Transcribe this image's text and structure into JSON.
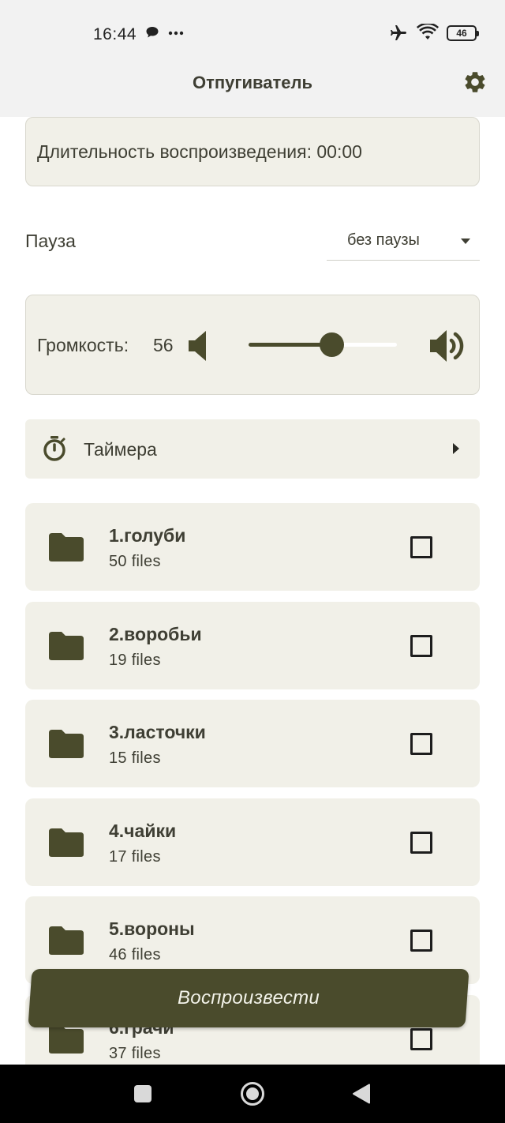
{
  "status_bar": {
    "time": "16:44",
    "battery_level": "46",
    "icons": [
      "chat-bubble-icon",
      "more-dots-icon",
      "airplane-icon",
      "wifi-icon",
      "battery-icon"
    ]
  },
  "app_bar": {
    "title": "Отпугиватель",
    "settings_icon": "gear-icon"
  },
  "duration": {
    "text": "Длительность воспроизведения: 00:00"
  },
  "pause": {
    "label": "Пауза",
    "selected": "без паузы"
  },
  "volume": {
    "label": "Громкость:",
    "value": "56",
    "level_percent": 56
  },
  "timers": {
    "label": "Таймера"
  },
  "folders": [
    {
      "name": "1.голуби",
      "count": "50 files",
      "checked": false
    },
    {
      "name": "2.воробьи",
      "count": "19 files",
      "checked": false
    },
    {
      "name": "3.ласточки",
      "count": "15 files",
      "checked": false
    },
    {
      "name": "4.чайки",
      "count": "17 files",
      "checked": false
    },
    {
      "name": "5.вороны",
      "count": "46 files",
      "checked": false
    },
    {
      "name": "6.грачи",
      "count": "37 files",
      "checked": false
    }
  ],
  "play_button": {
    "label": "Воспроизвести"
  },
  "colors": {
    "accent": "#4a4b2c",
    "card_background": "#f1f0e8",
    "text": "#3f3f34",
    "app_bar": "#f2f2f2"
  }
}
